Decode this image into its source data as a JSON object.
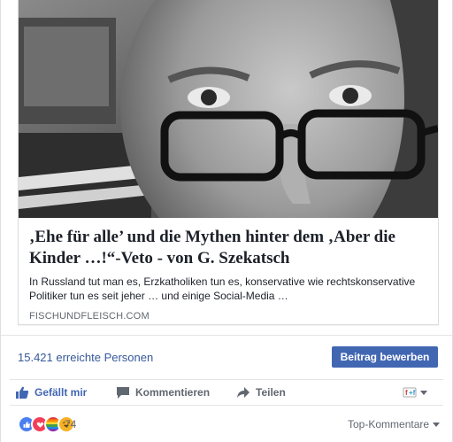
{
  "link_preview": {
    "title": "‚Ehe für alle’ und die Mythen hinter dem ‚Aber die Kinder …!“-Veto - von G. Szekatsch",
    "description": "In Russland tut man es, Erzkatholiken tun es, konservative wie rechtskonservative Politiker tun es seit jeher … und einige Social-Media …",
    "domain": "FISCHUNDFLEISCH.COM",
    "image_icon": "portrait-photo"
  },
  "insights": {
    "reach_text": "15.421 erreichte Personen",
    "boost_label": "Beitrag bewerben"
  },
  "actions": {
    "like_label": "Gefällt mir",
    "comment_label": "Kommentieren",
    "share_label": "Teilen"
  },
  "reactions": {
    "count": "74",
    "icons": [
      "like-reaction-icon",
      "love-reaction-icon",
      "pride-reaction-icon",
      "haha-reaction-icon"
    ],
    "sort_label": "Top-Kommentare"
  },
  "colors": {
    "link_blue": "#365899",
    "button_blue": "#4267b2",
    "muted_text": "#606770"
  }
}
